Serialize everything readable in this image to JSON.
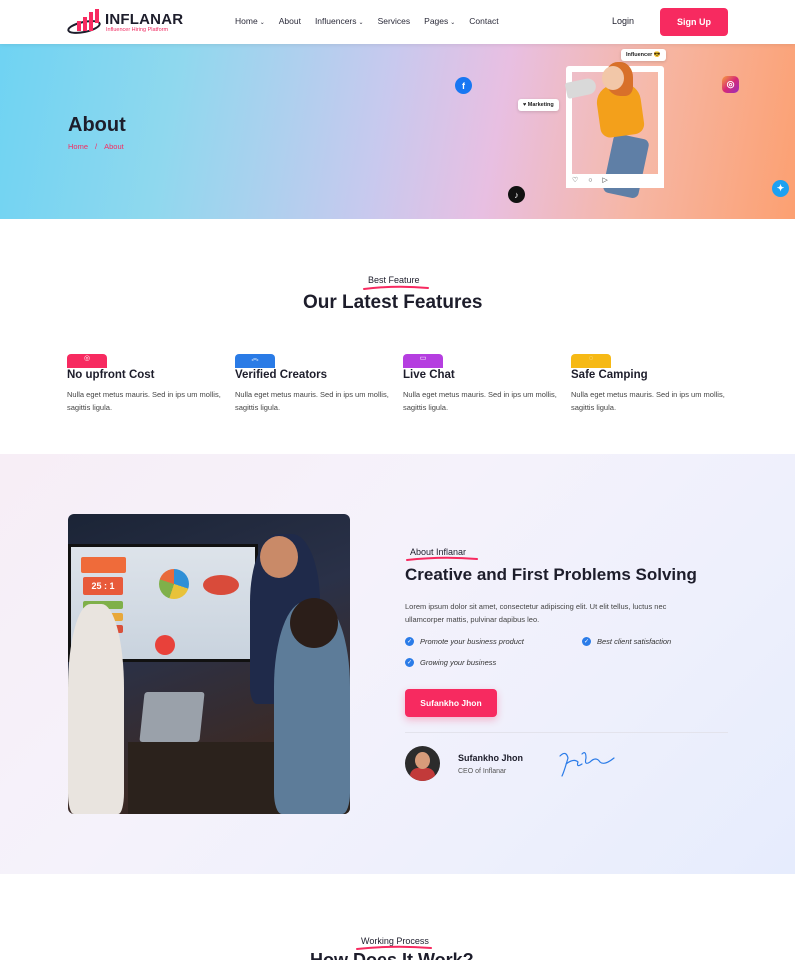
{
  "brand": {
    "name": "INFLANAR",
    "tagline": "Influencer Hiring Platform",
    "accent": "#f72a60",
    "dark": "#1d1d2b",
    "check_blue": "#2b7ce8"
  },
  "nav": {
    "items": [
      {
        "label": "Home",
        "dropdown": true
      },
      {
        "label": "About",
        "dropdown": false
      },
      {
        "label": "Influencers",
        "dropdown": true
      },
      {
        "label": "Services",
        "dropdown": false
      },
      {
        "label": "Pages",
        "dropdown": true
      },
      {
        "label": "Contact",
        "dropdown": false
      }
    ],
    "login": "Login",
    "signup": "Sign Up"
  },
  "hero": {
    "title": "About",
    "breadcrumb": {
      "home": "Home",
      "separator": "/",
      "current": "About"
    },
    "bubbles": {
      "influencer": "Influencer 😎",
      "marketing": "♥ Marketing"
    },
    "frame_icons": "♡ ○ ▷"
  },
  "features": {
    "kicker": "Best Feature",
    "title": "Our Latest Features",
    "items": [
      {
        "title": "No upfront Cost",
        "text": "Nulla eget metus mauris. Sed in ips um mollis, sagittis ligula.",
        "icon": "money-icon",
        "color": "#f72a60"
      },
      {
        "title": "Verified Creators",
        "text": "Nulla eget metus mauris. Sed in ips um mollis, sagittis ligula.",
        "icon": "verified-icon",
        "color": "#2a7be6"
      },
      {
        "title": "Live Chat",
        "text": "Nulla eget metus mauris. Sed in ips um mollis, sagittis ligula.",
        "icon": "live-icon",
        "color": "#b53ee0"
      },
      {
        "title": "Safe Camping",
        "text": "Nulla eget metus mauris. Sed in ips um mollis, sagittis ligula.",
        "icon": "shield-icon",
        "color": "#f6b915"
      }
    ]
  },
  "about": {
    "kicker": "About Inflanar",
    "title": "Creative and First Problems Solving",
    "text": "Lorem ipsum dolor sit amet, consectetur adipiscing elit. Ut elit tellus, luctus nec ullamcorper mattis, pulvinar dapibus leo.",
    "checks": [
      "Promote your business product",
      "Best client satisfaction",
      "Growing your business"
    ],
    "button": "Sufankho Jhon",
    "ceo_name": "Sufankho Jhon",
    "ceo_role": "CEO of Inflanar",
    "screen": {
      "big_number": "25 : 1"
    }
  },
  "process": {
    "kicker": "Working Process",
    "title": "How Does It Work?"
  }
}
